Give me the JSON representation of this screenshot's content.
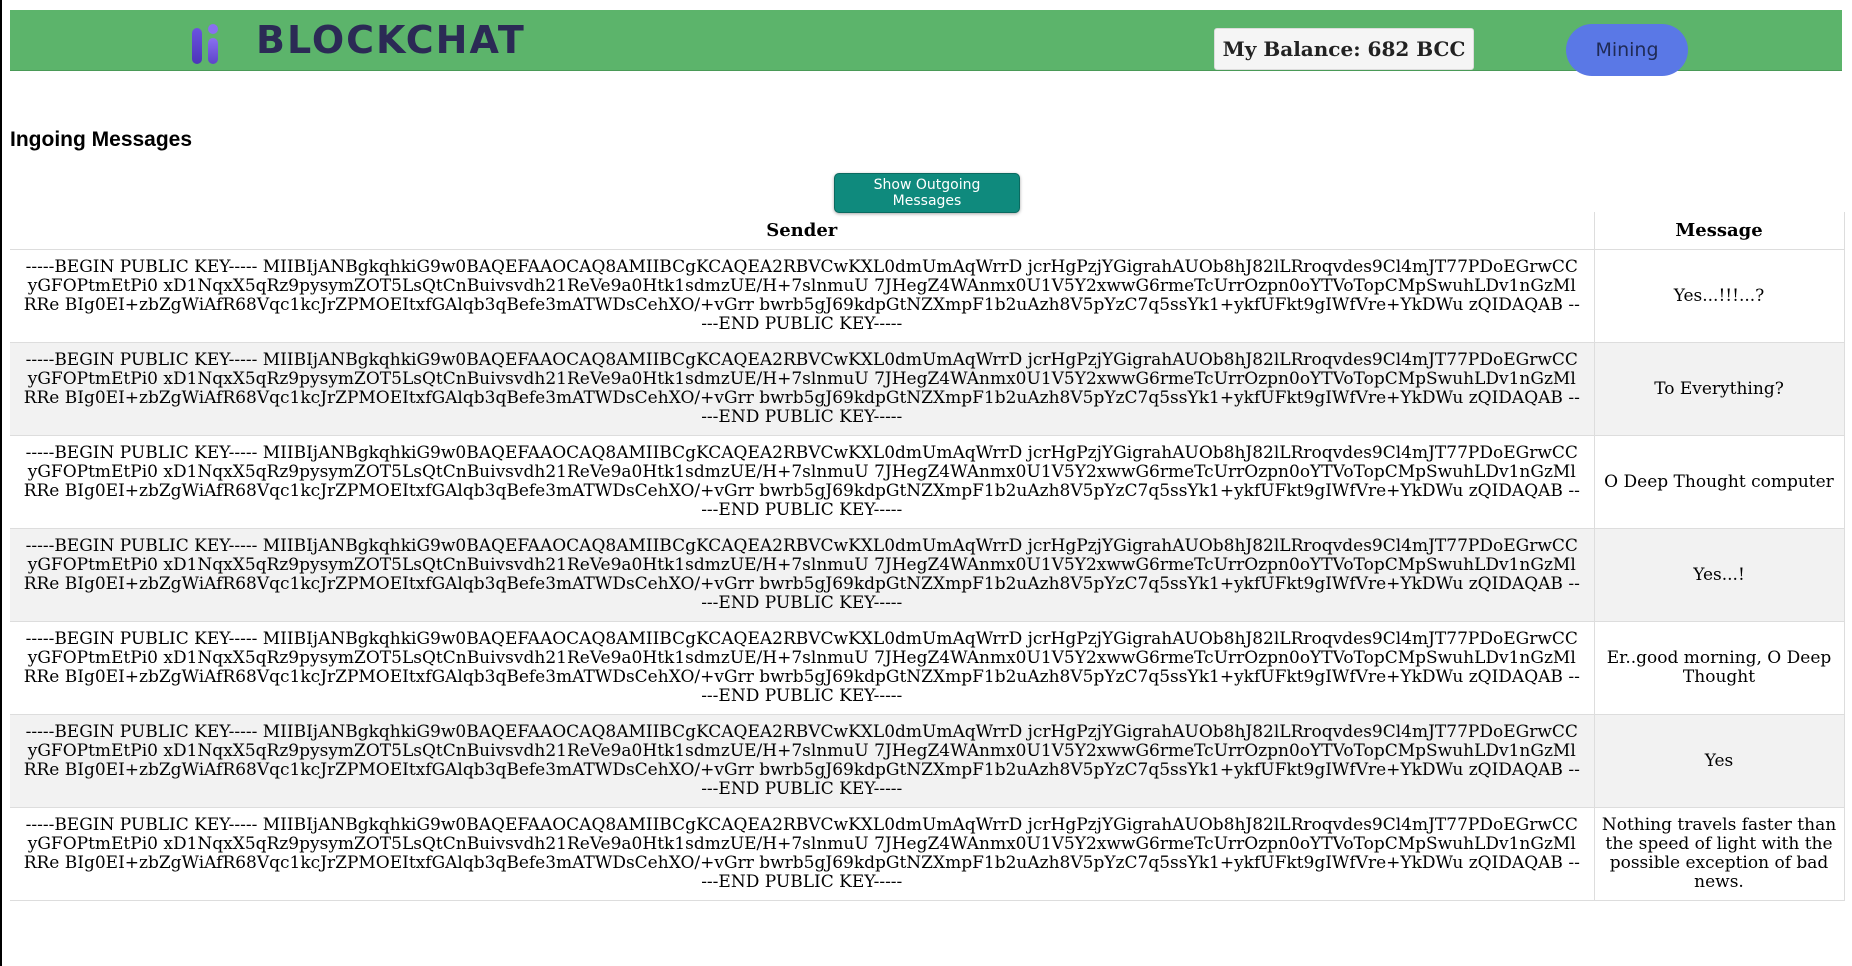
{
  "header": {
    "brand": "BLOCKCHAT",
    "balance_text": "My Balance: 682 BCC",
    "mining_label": "Mining",
    "navbar_color": "#5cb46b",
    "mining_color": "#5a78e6"
  },
  "main": {
    "title": "Ingoing Messages",
    "toggle_button_label": "Show Outgoing Messages",
    "toggle_color": "#0f8a7d"
  },
  "table": {
    "columns": [
      "Sender",
      "Message"
    ],
    "rows": [
      {
        "sender": "-----BEGIN PUBLIC KEY----- MIIBIjANBgkqhkiG9w0BAQEFAAOCAQ8AMIIBCgKCAQEA2RBVCwKXL0dmUmAqWrrD jcrHgPzjYGigrahAUOb8hJ82lLRroqvdes9Cl4mJT77PDoEGrwCCyGFOPtmEtPi0 xD1NqxX5qRz9pysymZOT5LsQtCnBuivsvdh21ReVe9a0Htk1sdmzUE/H+7slnmuU 7JHegZ4WAnmx0U1V5Y2xwwG6rmeTcUrrOzpn0oYTVoTopCMpSwuhLDv1nGzMlRRe BIg0EI+zbZgWiAfR68Vqc1kcJrZPMOEItxfGAlqb3qBefe3mATWDsCehXO/+vGrr bwrb5gJ69kdpGtNZXmpF1b2uAzh8V5pYzC7q5ssYk1+ykfUFkt9gIWfVre+YkDWu zQIDAQAB -----END PUBLIC KEY-----",
        "message": "Yes...!!!...?"
      },
      {
        "sender": "-----BEGIN PUBLIC KEY----- MIIBIjANBgkqhkiG9w0BAQEFAAOCAQ8AMIIBCgKCAQEA2RBVCwKXL0dmUmAqWrrD jcrHgPzjYGigrahAUOb8hJ82lLRroqvdes9Cl4mJT77PDoEGrwCCyGFOPtmEtPi0 xD1NqxX5qRz9pysymZOT5LsQtCnBuivsvdh21ReVe9a0Htk1sdmzUE/H+7slnmuU 7JHegZ4WAnmx0U1V5Y2xwwG6rmeTcUrrOzpn0oYTVoTopCMpSwuhLDv1nGzMlRRe BIg0EI+zbZgWiAfR68Vqc1kcJrZPMOEItxfGAlqb3qBefe3mATWDsCehXO/+vGrr bwrb5gJ69kdpGtNZXmpF1b2uAzh8V5pYzC7q5ssYk1+ykfUFkt9gIWfVre+YkDWu zQIDAQAB -----END PUBLIC KEY-----",
        "message": "To Everything?"
      },
      {
        "sender": "-----BEGIN PUBLIC KEY----- MIIBIjANBgkqhkiG9w0BAQEFAAOCAQ8AMIIBCgKCAQEA2RBVCwKXL0dmUmAqWrrD jcrHgPzjYGigrahAUOb8hJ82lLRroqvdes9Cl4mJT77PDoEGrwCCyGFOPtmEtPi0 xD1NqxX5qRz9pysymZOT5LsQtCnBuivsvdh21ReVe9a0Htk1sdmzUE/H+7slnmuU 7JHegZ4WAnmx0U1V5Y2xwwG6rmeTcUrrOzpn0oYTVoTopCMpSwuhLDv1nGzMlRRe BIg0EI+zbZgWiAfR68Vqc1kcJrZPMOEItxfGAlqb3qBefe3mATWDsCehXO/+vGrr bwrb5gJ69kdpGtNZXmpF1b2uAzh8V5pYzC7q5ssYk1+ykfUFkt9gIWfVre+YkDWu zQIDAQAB -----END PUBLIC KEY-----",
        "message": "O Deep Thought computer"
      },
      {
        "sender": "-----BEGIN PUBLIC KEY----- MIIBIjANBgkqhkiG9w0BAQEFAAOCAQ8AMIIBCgKCAQEA2RBVCwKXL0dmUmAqWrrD jcrHgPzjYGigrahAUOb8hJ82lLRroqvdes9Cl4mJT77PDoEGrwCCyGFOPtmEtPi0 xD1NqxX5qRz9pysymZOT5LsQtCnBuivsvdh21ReVe9a0Htk1sdmzUE/H+7slnmuU 7JHegZ4WAnmx0U1V5Y2xwwG6rmeTcUrrOzpn0oYTVoTopCMpSwuhLDv1nGzMlRRe BIg0EI+zbZgWiAfR68Vqc1kcJrZPMOEItxfGAlqb3qBefe3mATWDsCehXO/+vGrr bwrb5gJ69kdpGtNZXmpF1b2uAzh8V5pYzC7q5ssYk1+ykfUFkt9gIWfVre+YkDWu zQIDAQAB -----END PUBLIC KEY-----",
        "message": "Yes...!"
      },
      {
        "sender": "-----BEGIN PUBLIC KEY----- MIIBIjANBgkqhkiG9w0BAQEFAAOCAQ8AMIIBCgKCAQEA2RBVCwKXL0dmUmAqWrrD jcrHgPzjYGigrahAUOb8hJ82lLRroqvdes9Cl4mJT77PDoEGrwCCyGFOPtmEtPi0 xD1NqxX5qRz9pysymZOT5LsQtCnBuivsvdh21ReVe9a0Htk1sdmzUE/H+7slnmuU 7JHegZ4WAnmx0U1V5Y2xwwG6rmeTcUrrOzpn0oYTVoTopCMpSwuhLDv1nGzMlRRe BIg0EI+zbZgWiAfR68Vqc1kcJrZPMOEItxfGAlqb3qBefe3mATWDsCehXO/+vGrr bwrb5gJ69kdpGtNZXmpF1b2uAzh8V5pYzC7q5ssYk1+ykfUFkt9gIWfVre+YkDWu zQIDAQAB -----END PUBLIC KEY-----",
        "message": "Er..good morning, O Deep Thought"
      },
      {
        "sender": "-----BEGIN PUBLIC KEY----- MIIBIjANBgkqhkiG9w0BAQEFAAOCAQ8AMIIBCgKCAQEA2RBVCwKXL0dmUmAqWrrD jcrHgPzjYGigrahAUOb8hJ82lLRroqvdes9Cl4mJT77PDoEGrwCCyGFOPtmEtPi0 xD1NqxX5qRz9pysymZOT5LsQtCnBuivsvdh21ReVe9a0Htk1sdmzUE/H+7slnmuU 7JHegZ4WAnmx0U1V5Y2xwwG6rmeTcUrrOzpn0oYTVoTopCMpSwuhLDv1nGzMlRRe BIg0EI+zbZgWiAfR68Vqc1kcJrZPMOEItxfGAlqb3qBefe3mATWDsCehXO/+vGrr bwrb5gJ69kdpGtNZXmpF1b2uAzh8V5pYzC7q5ssYk1+ykfUFkt9gIWfVre+YkDWu zQIDAQAB -----END PUBLIC KEY-----",
        "message": "Yes"
      },
      {
        "sender": "-----BEGIN PUBLIC KEY----- MIIBIjANBgkqhkiG9w0BAQEFAAOCAQ8AMIIBCgKCAQEA2RBVCwKXL0dmUmAqWrrD jcrHgPzjYGigrahAUOb8hJ82lLRroqvdes9Cl4mJT77PDoEGrwCCyGFOPtmEtPi0 xD1NqxX5qRz9pysymZOT5LsQtCnBuivsvdh21ReVe9a0Htk1sdmzUE/H+7slnmuU 7JHegZ4WAnmx0U1V5Y2xwwG6rmeTcUrrOzpn0oYTVoTopCMpSwuhLDv1nGzMlRRe BIg0EI+zbZgWiAfR68Vqc1kcJrZPMOEItxfGAlqb3qBefe3mATWDsCehXO/+vGrr bwrb5gJ69kdpGtNZXmpF1b2uAzh8V5pYzC7q5ssYk1+ykfUFkt9gIWfVre+YkDWu zQIDAQAB -----END PUBLIC KEY-----",
        "message": "Nothing travels faster than the speed of light with the possible exception of bad news."
      }
    ]
  }
}
